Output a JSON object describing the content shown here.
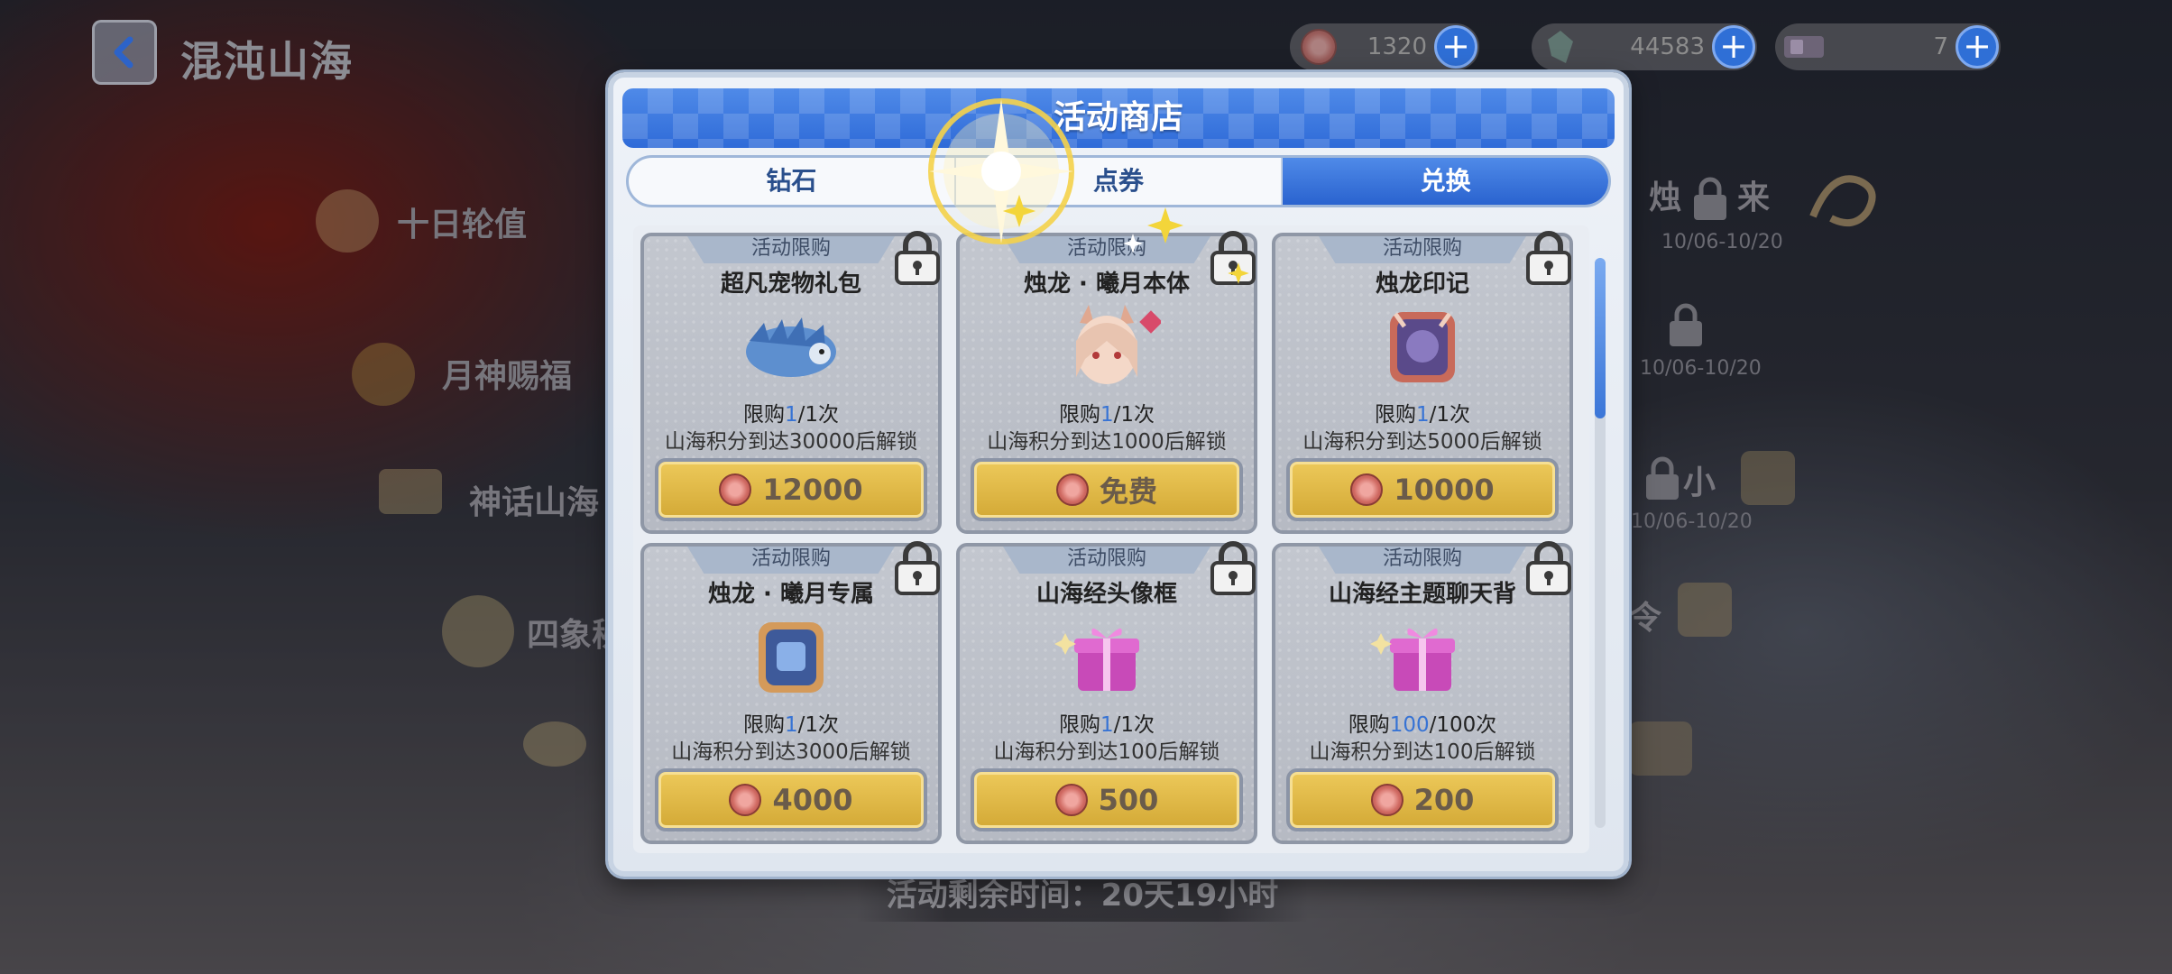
{
  "header": {
    "title": "混沌山海",
    "back_icon": "back-arrow-icon"
  },
  "resources": [
    {
      "icon": "coin-icon",
      "value": "1320"
    },
    {
      "icon": "crystal-icon",
      "value": "44583"
    },
    {
      "icon": "ticket-icon",
      "value": "7"
    }
  ],
  "background_menu": {
    "items": [
      "十日轮值",
      "月神赐福",
      "神话山海",
      "四象秘"
    ],
    "right_items": [
      {
        "label": "烛",
        "label2": "来",
        "date": "10/06-10/20"
      },
      {
        "label": "",
        "date": "10/06-10/20"
      },
      {
        "label": "小",
        "date": "10/06-10/20"
      },
      {
        "label": "令",
        "date": ""
      }
    ],
    "remaining": "活动剩余时间：20天19小时"
  },
  "shop": {
    "title": "活动商店",
    "tabs": [
      {
        "label": "钻石",
        "active": false
      },
      {
        "label": "点券",
        "active": false
      },
      {
        "label": "兑换",
        "active": true
      }
    ],
    "items": [
      {
        "ribbon": "活动限购",
        "name": "超凡宠物礼包",
        "limit_pre": "限购",
        "limit_cur": "1",
        "limit_post": "/1次",
        "unlock": "山海积分到达30000后解锁",
        "price": "12000",
        "art": "pet-dragon-icon"
      },
      {
        "ribbon": "活动限购",
        "name": "烛龙 · 曦月本体",
        "limit_pre": "限购",
        "limit_cur": "1",
        "limit_post": "/1次",
        "unlock": "山海积分到达1000后解锁",
        "price": "免费",
        "art": "character-portrait-icon"
      },
      {
        "ribbon": "活动限购",
        "name": "烛龙印记",
        "limit_pre": "限购",
        "limit_cur": "1",
        "limit_post": "/1次",
        "unlock": "山海积分到达5000后解锁",
        "price": "10000",
        "art": "emblem-icon"
      },
      {
        "ribbon": "活动限购",
        "name": "烛龙 · 曦月专属",
        "limit_pre": "限购",
        "limit_cur": "1",
        "limit_post": "/1次",
        "unlock": "山海积分到达3000后解锁",
        "price": "4000",
        "art": "exclusive-emblem-icon"
      },
      {
        "ribbon": "活动限购",
        "name": "山海经头像框",
        "limit_pre": "限购",
        "limit_cur": "1",
        "limit_post": "/1次",
        "unlock": "山海积分到达100后解锁",
        "price": "500",
        "art": "gift-box-icon"
      },
      {
        "ribbon": "活动限购",
        "name": "山海经主题聊天背",
        "limit_pre": "限购",
        "limit_cur": "100",
        "limit_post": "/100次",
        "unlock": "山海积分到达100后解锁",
        "price": "200",
        "art": "gift-box-icon"
      }
    ]
  },
  "colors": {
    "accent_blue": "#2f6bd8",
    "button_gold": "#e0b847",
    "highlight_blue": "#3773d4"
  }
}
